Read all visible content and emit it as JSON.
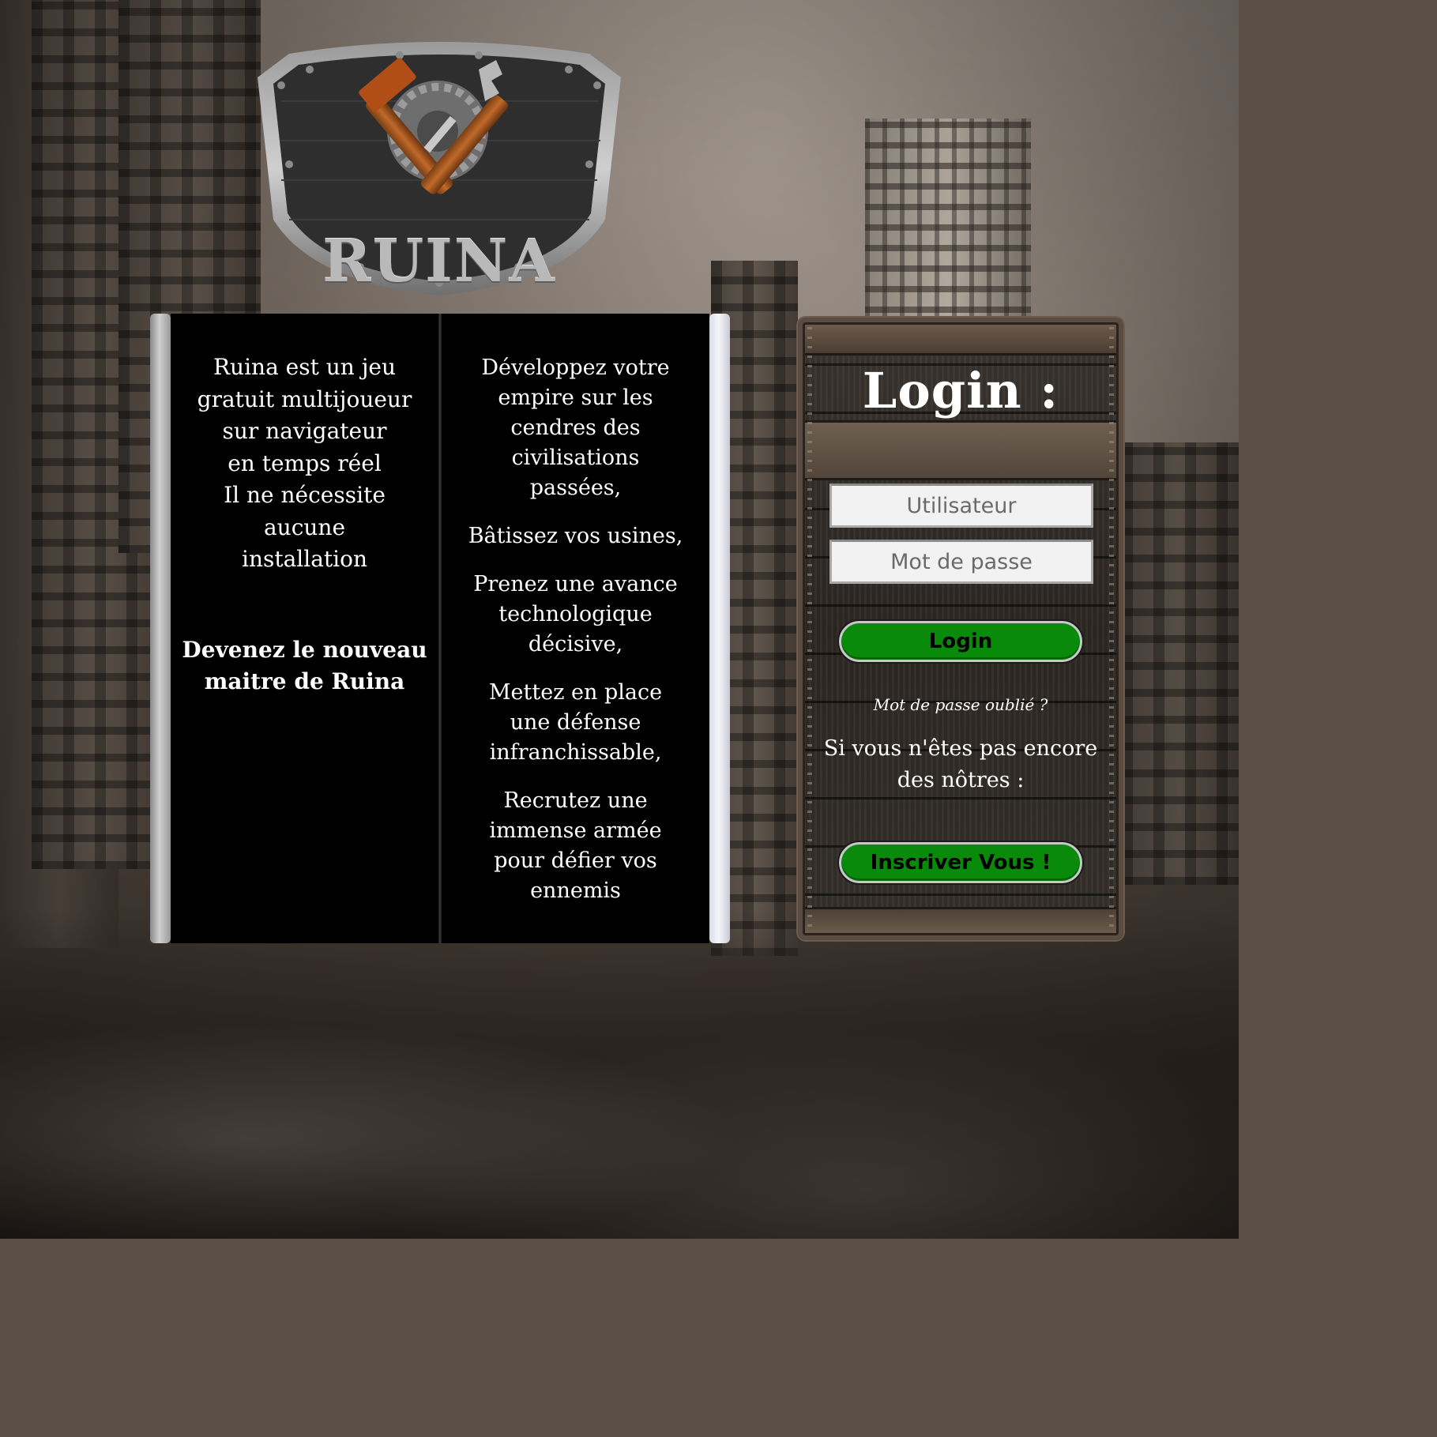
{
  "logo": {
    "title": "RUINA"
  },
  "intro": {
    "lines": [
      "Ruina est un jeu",
      "gratuit multijoueur",
      "sur navigateur",
      "en temps réel",
      "Il ne nécessite aucune",
      "installation"
    ],
    "call_lines": [
      "Devenez le nouveau",
      "maitre de Ruina"
    ]
  },
  "features": [
    {
      "lines": [
        "Développez votre",
        "empire sur les",
        "cendres des",
        "civilisations",
        "passées,"
      ]
    },
    {
      "lines": [
        "Bâtissez vos usines,"
      ]
    },
    {
      "lines": [
        "Prenez une avance",
        "technologique",
        "décisive,"
      ]
    },
    {
      "lines": [
        "Mettez en place",
        "une défense",
        "infranchissable,"
      ]
    },
    {
      "lines": [
        "Recrutez une",
        "immense armée",
        "pour défier vos",
        "ennemis"
      ]
    }
  ],
  "login": {
    "title": "Login :",
    "username_placeholder": "Utilisateur",
    "password_placeholder": "Mot de passe",
    "login_button": "Login",
    "forgot_link": "Mot de passe oublié ?",
    "not_yet_lines": [
      "Si vous n'êtes pas encore",
      "des nôtres :"
    ],
    "register_button": "Inscriver Vous !"
  },
  "colors": {
    "button_green": "#0a8a0a",
    "panel_black": "#000000",
    "text_white": "#ffffff"
  }
}
